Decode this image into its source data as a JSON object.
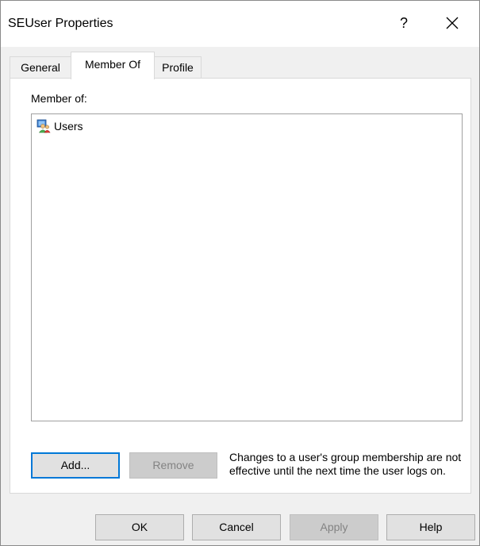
{
  "window": {
    "title": "SEUser Properties",
    "help_glyph": "?",
    "close_icon": "close-icon"
  },
  "tabs": [
    {
      "label": "General",
      "active": false
    },
    {
      "label": "Member Of",
      "active": true
    },
    {
      "label": "Profile",
      "active": false
    }
  ],
  "member_of": {
    "label": "Member of:",
    "items": [
      {
        "name": "Users",
        "icon": "group-icon"
      }
    ],
    "add_label": "Add...",
    "remove_label": "Remove",
    "note": "Changes to a user's group membership are not effective until the next time the user logs on."
  },
  "footer": {
    "ok_label": "OK",
    "cancel_label": "Cancel",
    "apply_label": "Apply",
    "help_label": "Help"
  },
  "colors": {
    "dialog_bg": "#f0f0f0",
    "focus_border": "#0078d7",
    "disabled_text": "#838383"
  }
}
